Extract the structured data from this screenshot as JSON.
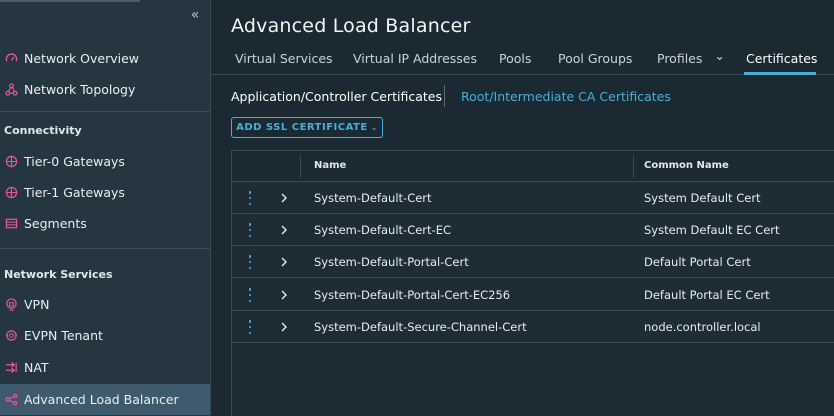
{
  "sidebar": {
    "collapse_glyph": "«",
    "items_top": [
      {
        "label": "Network Overview",
        "icon": "gauge-icon"
      },
      {
        "label": "Network Topology",
        "icon": "topology-icon"
      }
    ],
    "sections": [
      {
        "title": "Connectivity",
        "items": [
          {
            "label": "Tier-0 Gateways",
            "icon": "gateway-icon"
          },
          {
            "label": "Tier-1 Gateways",
            "icon": "gateway-icon"
          },
          {
            "label": "Segments",
            "icon": "segments-icon"
          }
        ]
      },
      {
        "title": "Network Services",
        "items": [
          {
            "label": "VPN",
            "icon": "vpn-icon"
          },
          {
            "label": "EVPN Tenant",
            "icon": "evpn-icon"
          },
          {
            "label": "NAT",
            "icon": "nat-icon"
          },
          {
            "label": "Advanced Load Balancer",
            "icon": "load-balancer-icon",
            "active": true
          }
        ]
      }
    ]
  },
  "main": {
    "title": "Advanced Load Balancer",
    "tabs": [
      {
        "label": "Virtual Services"
      },
      {
        "label": "Virtual IP Addresses"
      },
      {
        "label": "Pools"
      },
      {
        "label": "Pool Groups"
      },
      {
        "label": "Profiles",
        "dropdown": "⌄"
      },
      {
        "label": "Certificates",
        "active": true
      }
    ],
    "subtabs": [
      {
        "label": "Application/Controller Certificates",
        "active": true
      },
      {
        "label": "Root/Intermediate CA Certificates"
      }
    ],
    "add_button": {
      "label": "ADD SSL CERTIFICATE",
      "caret": "⌄"
    },
    "table": {
      "columns": [
        "Name",
        "Common Name"
      ],
      "rows": [
        {
          "name": "System-Default-Cert",
          "common_name": "System Default Cert"
        },
        {
          "name": "System-Default-Cert-EC",
          "common_name": "System Default EC Cert"
        },
        {
          "name": "System-Default-Portal-Cert",
          "common_name": "Default Portal Cert"
        },
        {
          "name": "System-Default-Portal-Cert-EC256",
          "common_name": "Default Portal EC Cert"
        },
        {
          "name": "System-Default-Secure-Channel-Cert",
          "common_name": "node.controller.local"
        }
      ]
    }
  },
  "colors": {
    "accent": "#49afd9",
    "icon_pink": "#e9579b",
    "active_item_bg": "#3e5a6c"
  }
}
